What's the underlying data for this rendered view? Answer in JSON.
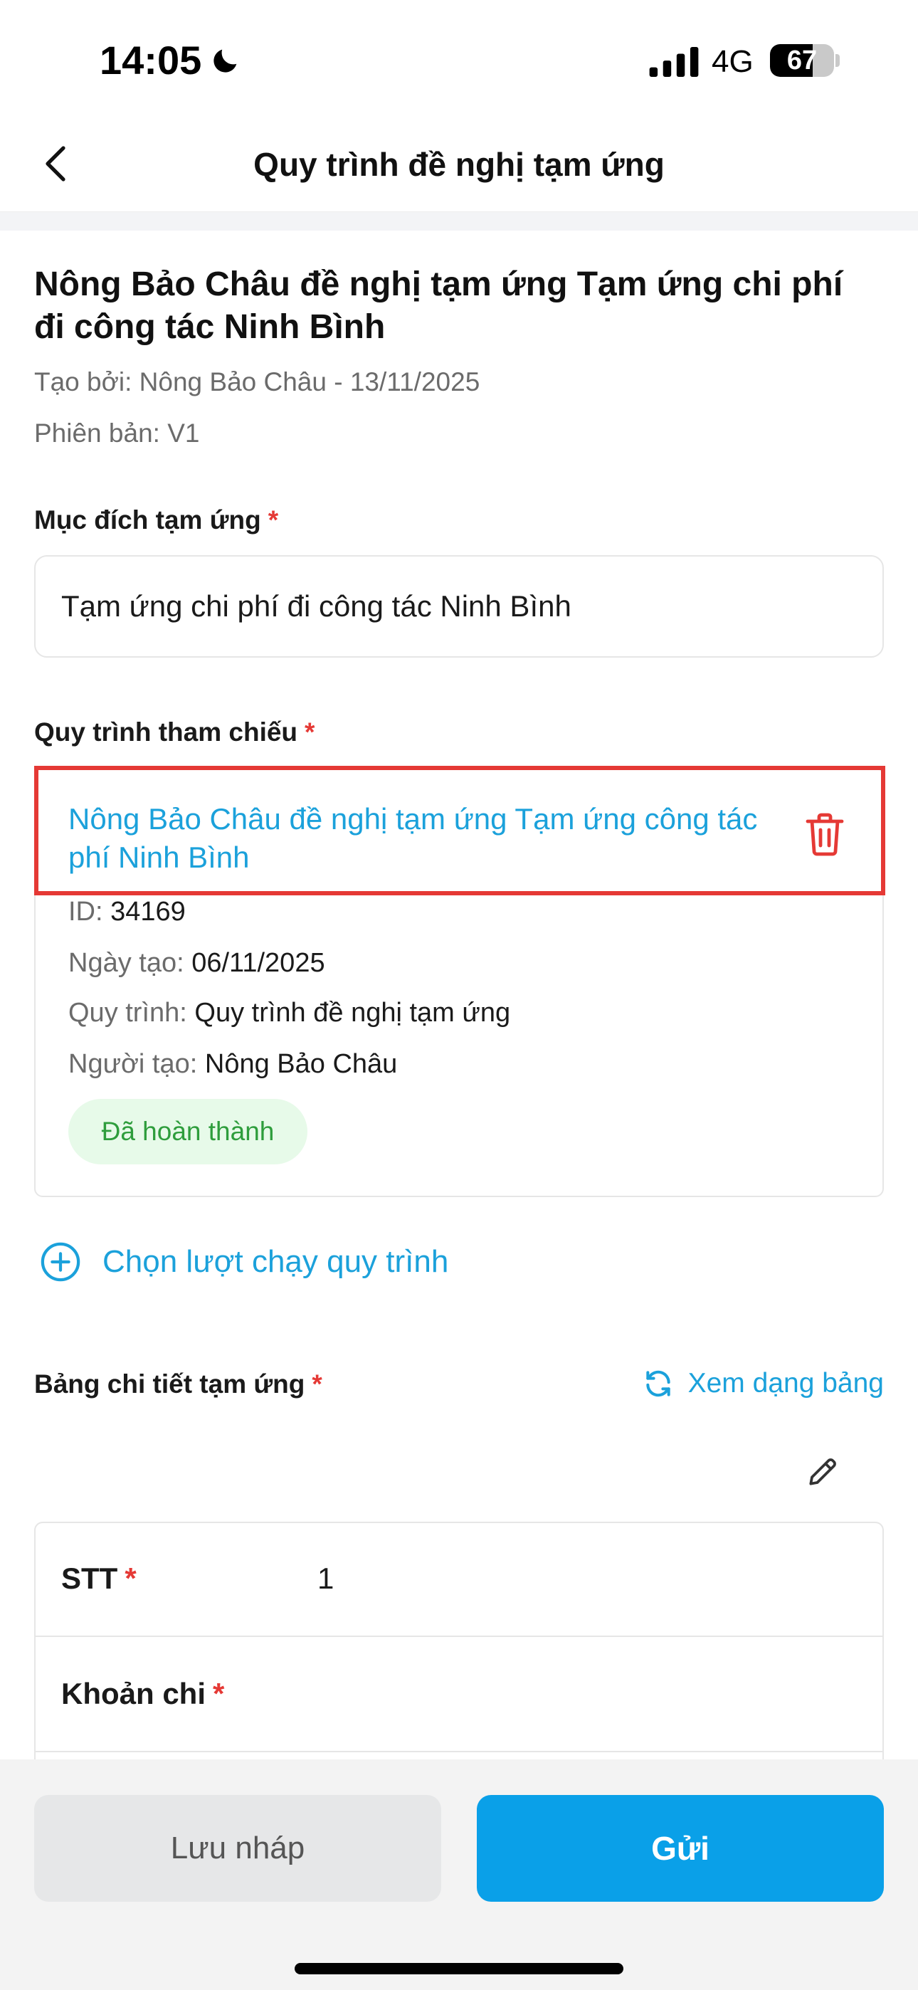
{
  "status_bar": {
    "time": "14:05",
    "network": "4G",
    "battery_percent": "67",
    "battery_level": 0.67,
    "icons": [
      "moon-icon",
      "signal-icon",
      "battery-icon"
    ]
  },
  "nav": {
    "title": "Quy trình đề nghị tạm ứng",
    "back_icon": "chevron-left-icon"
  },
  "request": {
    "title": "Nông Bảo Châu đề nghị tạm ứng Tạm ứng chi phí đi công tác Ninh Bình",
    "created_by": "Tạo bởi: Nông Bảo Châu  - 13/11/2025",
    "version": "Phiên bản: V1"
  },
  "purpose": {
    "label": "Mục đích tạm ứng",
    "required": "*",
    "value": "Tạm ứng chi phí đi công tác Ninh Bình"
  },
  "reference": {
    "label": "Quy trình tham chiếu",
    "required": "*",
    "title": "Nông Bảo Châu đề nghị tạm ứng Tạm ứng công tác phí Ninh Bình",
    "id_key": "ID:",
    "id_value": "34169",
    "date_key": "Ngày tạo:",
    "date_value": "06/11/2025",
    "process_key": "Quy trình:",
    "process_value": "Quy trình đề nghị tạm ứng",
    "creator_key": "Người tạo:",
    "creator_value": "Nông Bảo Châu",
    "status": "Đã hoàn thành"
  },
  "add_run": {
    "label": "Chọn lượt chạy quy trình"
  },
  "detail": {
    "label": "Bảng chi tiết tạm ứng",
    "required": "*",
    "view_table": "Xem dạng bảng",
    "rows": [
      {
        "key": "STT",
        "required": "*",
        "value": "1"
      },
      {
        "key": "Khoản chi",
        "required": "*",
        "value": ""
      }
    ]
  },
  "actions": {
    "draft": "Lưu nháp",
    "send": "Gửi"
  },
  "colors": {
    "accent": "#1ba1db",
    "primary_button": "#0aa0e8",
    "required": "#e53935",
    "highlight_border": "#e53935",
    "success_text": "#2e9d3c",
    "success_bg": "#e7fae9"
  }
}
